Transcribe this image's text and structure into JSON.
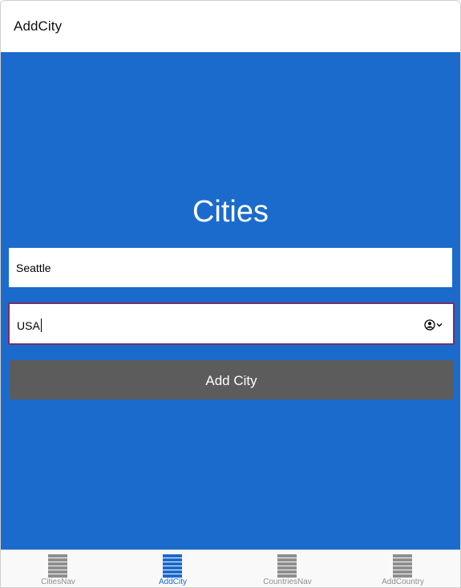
{
  "nav": {
    "title": "AddCity"
  },
  "main": {
    "heading": "Cities",
    "city_field": {
      "value": "Seattle"
    },
    "country_field": {
      "value": "USA"
    },
    "add_button_label": "Add City"
  },
  "tabs": [
    {
      "label": "CitiesNav",
      "icon": "list-icon",
      "active": false
    },
    {
      "label": "AddCity",
      "icon": "list-icon",
      "active": true
    },
    {
      "label": "CountriesNav",
      "icon": "list-icon",
      "active": false
    },
    {
      "label": "AddCountry",
      "icon": "list-icon",
      "active": false
    }
  ],
  "colors": {
    "content_bg": "#1a6bcc",
    "button_bg": "#5c5c5c",
    "active_tab": "#1a6bcc",
    "inactive_tab": "#8e8e8e",
    "focus_border": "#7a2d6a"
  }
}
